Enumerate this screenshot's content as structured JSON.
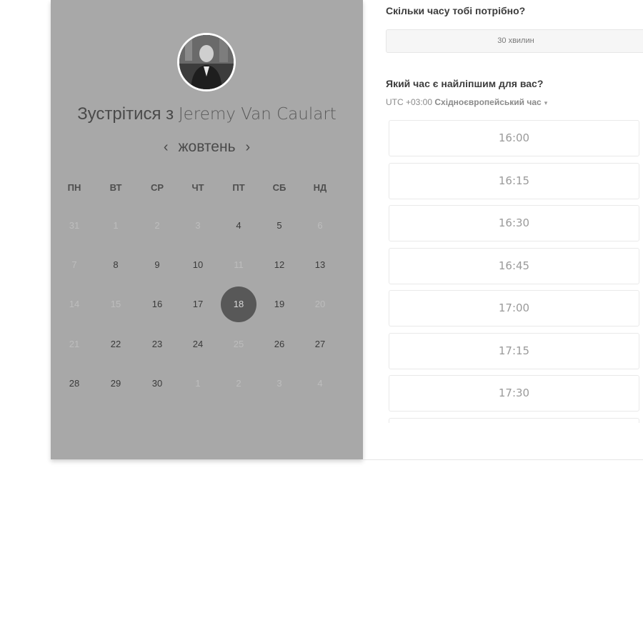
{
  "calendar": {
    "meet_prefix": "Зустрітися з",
    "host_name": "Jeremy Van Caulart",
    "month": "жовтень",
    "prev_arrow": "‹",
    "next_arrow": "›",
    "weekdays": [
      "ПН",
      "ВТ",
      "СР",
      "ЧТ",
      "ПТ",
      "СБ",
      "НД"
    ],
    "weeks": [
      [
        {
          "d": "31",
          "muted": true
        },
        {
          "d": "1",
          "muted": true
        },
        {
          "d": "2",
          "muted": true
        },
        {
          "d": "3",
          "muted": true
        },
        {
          "d": "4"
        },
        {
          "d": "5"
        },
        {
          "d": "6",
          "muted": true
        }
      ],
      [
        {
          "d": "7",
          "muted": true
        },
        {
          "d": "8"
        },
        {
          "d": "9"
        },
        {
          "d": "10"
        },
        {
          "d": "11",
          "muted": true
        },
        {
          "d": "12"
        },
        {
          "d": "13"
        }
      ],
      [
        {
          "d": "14",
          "muted": true
        },
        {
          "d": "15",
          "muted": true
        },
        {
          "d": "16"
        },
        {
          "d": "17"
        },
        {
          "d": "18",
          "selected": true
        },
        {
          "d": "19"
        },
        {
          "d": "20",
          "muted": true
        }
      ],
      [
        {
          "d": "21",
          "muted": true
        },
        {
          "d": "22"
        },
        {
          "d": "23"
        },
        {
          "d": "24"
        },
        {
          "d": "25",
          "muted": true
        },
        {
          "d": "26"
        },
        {
          "d": "27"
        }
      ],
      [
        {
          "d": "28"
        },
        {
          "d": "29"
        },
        {
          "d": "30"
        },
        {
          "d": "1",
          "muted": true
        },
        {
          "d": "2",
          "muted": true
        },
        {
          "d": "3",
          "muted": true
        },
        {
          "d": "4",
          "muted": true
        }
      ]
    ]
  },
  "booking": {
    "duration_question": "Скільки часу тобі потрібно?",
    "duration_value": "30 хвилин",
    "time_question": "Який час є найліпшим для вас?",
    "tz_offset": "UTC +03:00",
    "tz_name": "Східноєвропейський час",
    "tz_caret": "▾",
    "slots": [
      "16:00",
      "16:15",
      "16:30",
      "16:45",
      "17:00",
      "17:15",
      "17:30",
      ""
    ]
  },
  "colors": {
    "panel_bg": "#a8a8a8",
    "selected_day": "#585858"
  }
}
